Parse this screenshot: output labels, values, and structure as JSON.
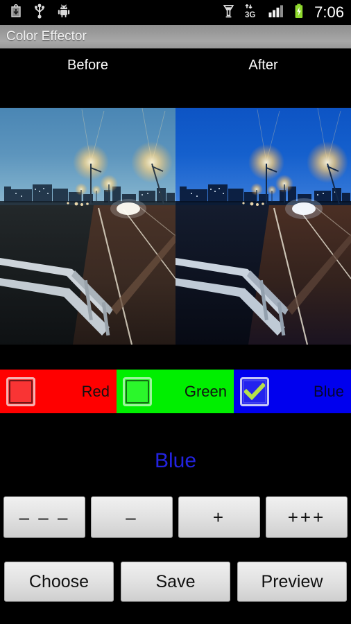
{
  "status_bar": {
    "left_icons": [
      {
        "name": "download-icon",
        "label": "download"
      },
      {
        "name": "usb-icon",
        "label": "usb"
      },
      {
        "name": "android-debug-icon",
        "label": "android"
      }
    ],
    "right_icons": [
      {
        "name": "alarm-icon",
        "label": "alarm"
      },
      {
        "name": "network-3g-icon",
        "label": "3G"
      },
      {
        "name": "signal-bars-icon",
        "label": "signal"
      },
      {
        "name": "battery-charging-icon",
        "label": "battery"
      }
    ],
    "network_label": "3G",
    "clock": "7:06"
  },
  "titlebar": {
    "title": "Color Effector"
  },
  "preview": {
    "before_label": "Before",
    "after_label": "After"
  },
  "channels": [
    {
      "id": "red",
      "label": "Red",
      "checked": false,
      "cell_color": "#ff0000",
      "box_color": "#f93434"
    },
    {
      "id": "green",
      "label": "Green",
      "checked": false,
      "cell_color": "#00ef00",
      "box_color": "#2bf72b"
    },
    {
      "id": "blue",
      "label": "Blue",
      "checked": true,
      "cell_color": "#0000ee",
      "box_color": "#2323ee"
    }
  ],
  "selected_channel": {
    "label": "Blue",
    "color": "#2323e0"
  },
  "step_buttons": [
    {
      "name": "decrease-large-button",
      "label": "– – –"
    },
    {
      "name": "decrease-small-button",
      "label": "–"
    },
    {
      "name": "increase-small-button",
      "label": "+"
    },
    {
      "name": "increase-large-button",
      "label": "+++"
    }
  ],
  "action_buttons": [
    {
      "name": "choose-button",
      "label": "Choose"
    },
    {
      "name": "save-button",
      "label": "Save"
    },
    {
      "name": "preview-button",
      "label": "Preview"
    }
  ]
}
